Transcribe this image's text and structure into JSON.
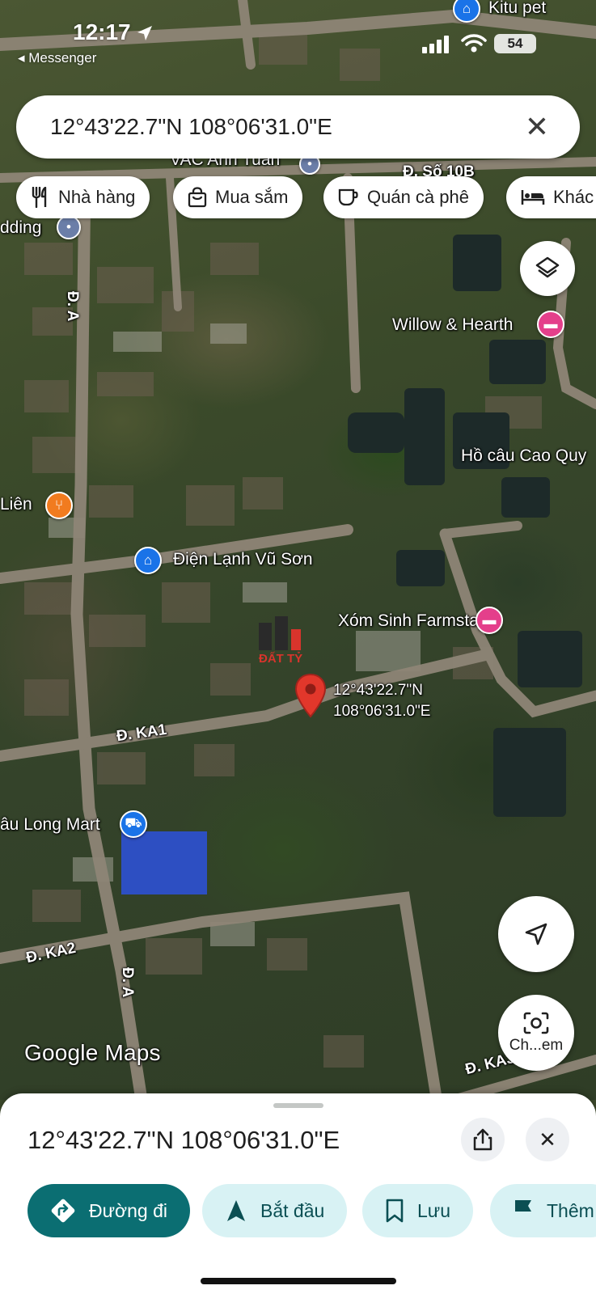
{
  "status_bar": {
    "time": "12:17",
    "back_app": "◂ Messenger",
    "battery": "54"
  },
  "search": {
    "query": "12°43'22.7\"N 108°06'31.0\"E"
  },
  "chips": [
    {
      "label": "Nhà hàng",
      "icon": "restaurant-icon"
    },
    {
      "label": "Mua sắm",
      "icon": "shopping-bag-icon"
    },
    {
      "label": "Quán cà phê",
      "icon": "coffee-cup-icon"
    },
    {
      "label": "Khác",
      "icon": "bed-icon"
    }
  ],
  "map": {
    "top_poi": "Kitu pet",
    "poi_vac": "VAC Anh Tuấn",
    "poi_wedding": "dding",
    "poi_willow": "Willow & Hearth",
    "poi_hocau": "Hồ câu Cao Quy",
    "poi_lien": "Liên",
    "poi_dienlanh": "Điện Lạnh Vũ Sơn",
    "poi_xomsinh": "Xóm Sinh Farmstay",
    "poi_mart": "âu Long Mart",
    "road_so10b": "Đ. Số 10B",
    "road_a_top": "Đ. A",
    "road_ka1": "Đ. KA1",
    "road_ka2": "Đ. KA2",
    "road_a_bottom": "Đ. A",
    "road_ka3": "Đ. KA3",
    "pin_lat": "12°43'22.7\"N",
    "pin_lng": "108°06'31.0\"E",
    "watermark": "ĐẤT TỶ",
    "brand": "Google Maps",
    "lens_label": "Ch...em",
    "colors": {
      "lodging_pin": "#e43f8b",
      "food_pin": "#f17b1f",
      "shop_pin": "#1a73e8",
      "dropped_pin": "#e2372b"
    }
  },
  "sheet": {
    "title": "12°43'22.7\"N 108°06'31.0\"E",
    "actions": [
      {
        "label": "Đường đi",
        "icon": "directions-icon"
      },
      {
        "label": "Bắt đầu",
        "icon": "navigation-arrow-icon"
      },
      {
        "label": "Lưu",
        "icon": "bookmark-icon"
      },
      {
        "label": "Thêm",
        "icon": "flag-icon"
      }
    ],
    "colors": {
      "primary": "#0b6e72",
      "secondary": "#d8f2f4"
    }
  }
}
